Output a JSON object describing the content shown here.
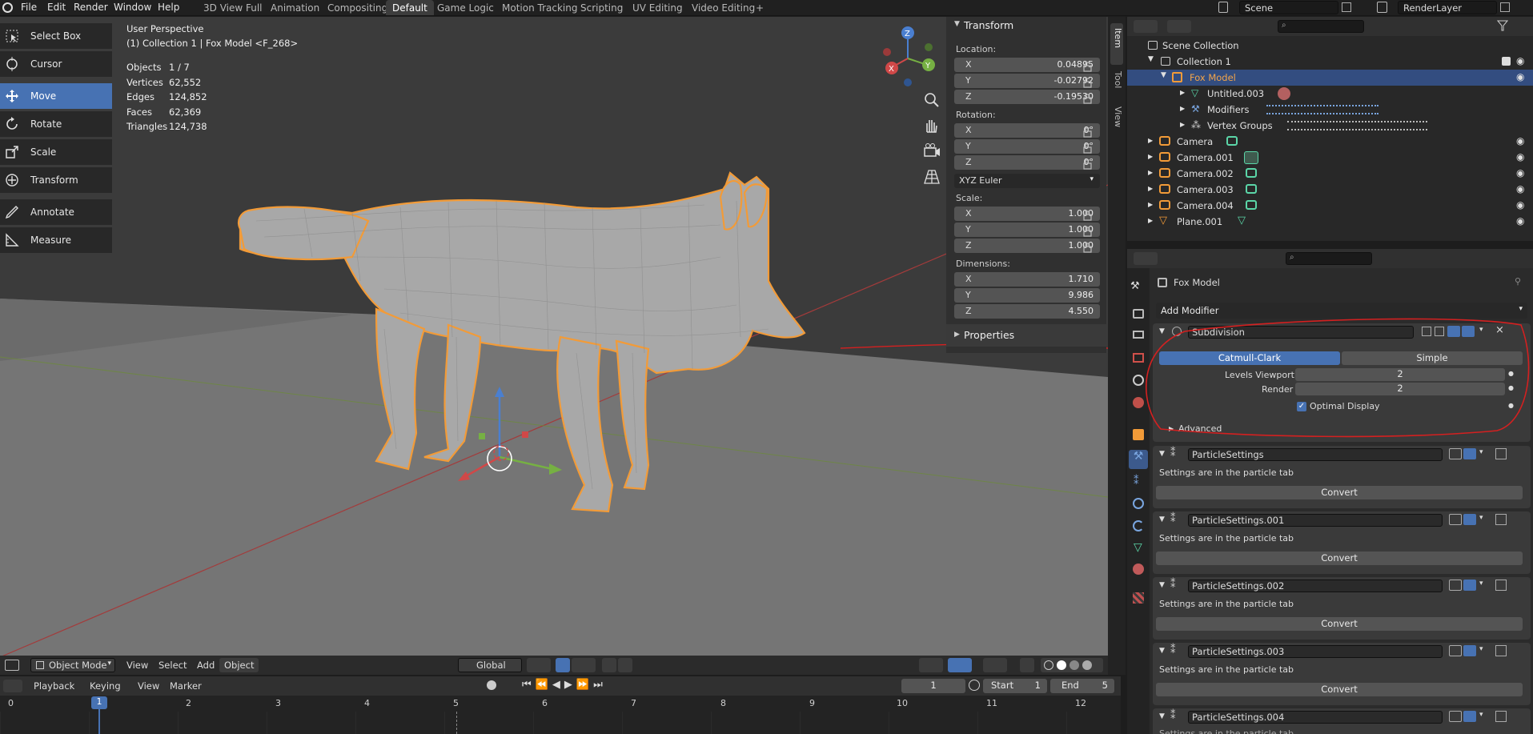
{
  "topbar": {
    "menus": [
      "File",
      "Edit",
      "Render",
      "Window",
      "Help"
    ],
    "workspaces": [
      "3D View Full",
      "Animation",
      "Compositing",
      "Default",
      "Game Logic",
      "Motion Tracking",
      "Scripting",
      "UV Editing",
      "Video Editing"
    ],
    "active_workspace": "Default",
    "add_tab": "+",
    "scene": "Scene",
    "render_layer": "RenderLayer"
  },
  "toolbar": {
    "tools": [
      "Select Box",
      "Cursor",
      "Move",
      "Rotate",
      "Scale",
      "Transform",
      "Annotate",
      "Measure"
    ],
    "active": "Move"
  },
  "viewport": {
    "perspective": "User Perspective",
    "collection_line": "(1) Collection 1 | Fox Model <F_268>",
    "stats": [
      {
        "label": "Objects",
        "value": "1 / 7"
      },
      {
        "label": "Vertices",
        "value": "62,552"
      },
      {
        "label": "Edges",
        "value": "124,852"
      },
      {
        "label": "Faces",
        "value": "62,369"
      },
      {
        "label": "Triangles",
        "value": "124,738"
      }
    ],
    "gizmo_axes": [
      "X",
      "Y",
      "Z"
    ],
    "header": {
      "mode": "Object Mode",
      "menus": [
        "View",
        "Select",
        "Add",
        "Object"
      ],
      "orientation": "Global"
    },
    "colors": {
      "background": "#3b3b3b",
      "floor": "#757575",
      "selection": "#f29b38",
      "mesh": "#a8a8a8"
    }
  },
  "npanel": {
    "tabs": [
      "Item",
      "Tool",
      "View"
    ],
    "transform_title": "Transform",
    "location_label": "Location:",
    "location": [
      {
        "axis": "X",
        "value": "0.04895"
      },
      {
        "axis": "Y",
        "value": "-0.02792"
      },
      {
        "axis": "Z",
        "value": "-0.19530"
      }
    ],
    "rotation_label": "Rotation:",
    "rotation": [
      {
        "axis": "X",
        "value": "0°"
      },
      {
        "axis": "Y",
        "value": "0°"
      },
      {
        "axis": "Z",
        "value": "0°"
      }
    ],
    "rotation_mode": "XYZ Euler",
    "scale_label": "Scale:",
    "scale": [
      {
        "axis": "X",
        "value": "1.000"
      },
      {
        "axis": "Y",
        "value": "1.000"
      },
      {
        "axis": "Z",
        "value": "1.000"
      }
    ],
    "dimensions_label": "Dimensions:",
    "dimensions": [
      {
        "axis": "X",
        "value": "1.710"
      },
      {
        "axis": "Y",
        "value": "9.986"
      },
      {
        "axis": "Z",
        "value": "4.550"
      }
    ],
    "properties_title": "Properties"
  },
  "outliner": {
    "rows": [
      {
        "label": "Scene Collection"
      },
      {
        "label": "Collection 1"
      },
      {
        "label": "Fox Model"
      },
      {
        "label": "Untitled.003"
      },
      {
        "label": "Modifiers"
      },
      {
        "label": "Vertex Groups"
      },
      {
        "label": "Camera"
      },
      {
        "label": "Camera.001"
      },
      {
        "label": "Camera.002"
      },
      {
        "label": "Camera.003"
      },
      {
        "label": "Camera.004"
      },
      {
        "label": "Plane.001"
      }
    ]
  },
  "properties": {
    "object_name": "Fox Model",
    "add_modifier": "Add Modifier",
    "subdivision": {
      "name": "Subdivision",
      "mode_catmull": "Catmull-Clark",
      "mode_simple": "Simple",
      "active_mode": "Catmull-Clark",
      "levels_viewport_label": "Levels Viewport",
      "levels_viewport": "2",
      "render_label": "Render",
      "render": "2",
      "optimal_display": "Optimal Display",
      "optimal_display_checked": true,
      "advanced": "Advanced"
    },
    "particle_modifiers": [
      {
        "name": "ParticleSettings",
        "note": "Settings are in the particle tab",
        "button": "Convert"
      },
      {
        "name": "ParticleSettings.001",
        "note": "Settings are in the particle tab",
        "button": "Convert"
      },
      {
        "name": "ParticleSettings.002",
        "note": "Settings are in the particle tab",
        "button": "Convert"
      },
      {
        "name": "ParticleSettings.003",
        "note": "Settings are in the particle tab",
        "button": "Convert"
      },
      {
        "name": "ParticleSettings.004",
        "note": "Settings are in the particle tab",
        "button": "Convert"
      }
    ]
  },
  "timeline": {
    "menus": [
      "Playback",
      "Keying",
      "View",
      "Marker"
    ],
    "current_frame": "1",
    "start_label": "Start",
    "start": "1",
    "end_label": "End",
    "end": "5",
    "ticks": [
      "0",
      "1",
      "2",
      "3",
      "4",
      "5",
      "6",
      "7",
      "8",
      "9",
      "10",
      "11",
      "12"
    ]
  },
  "annotation_color": "#d42020"
}
